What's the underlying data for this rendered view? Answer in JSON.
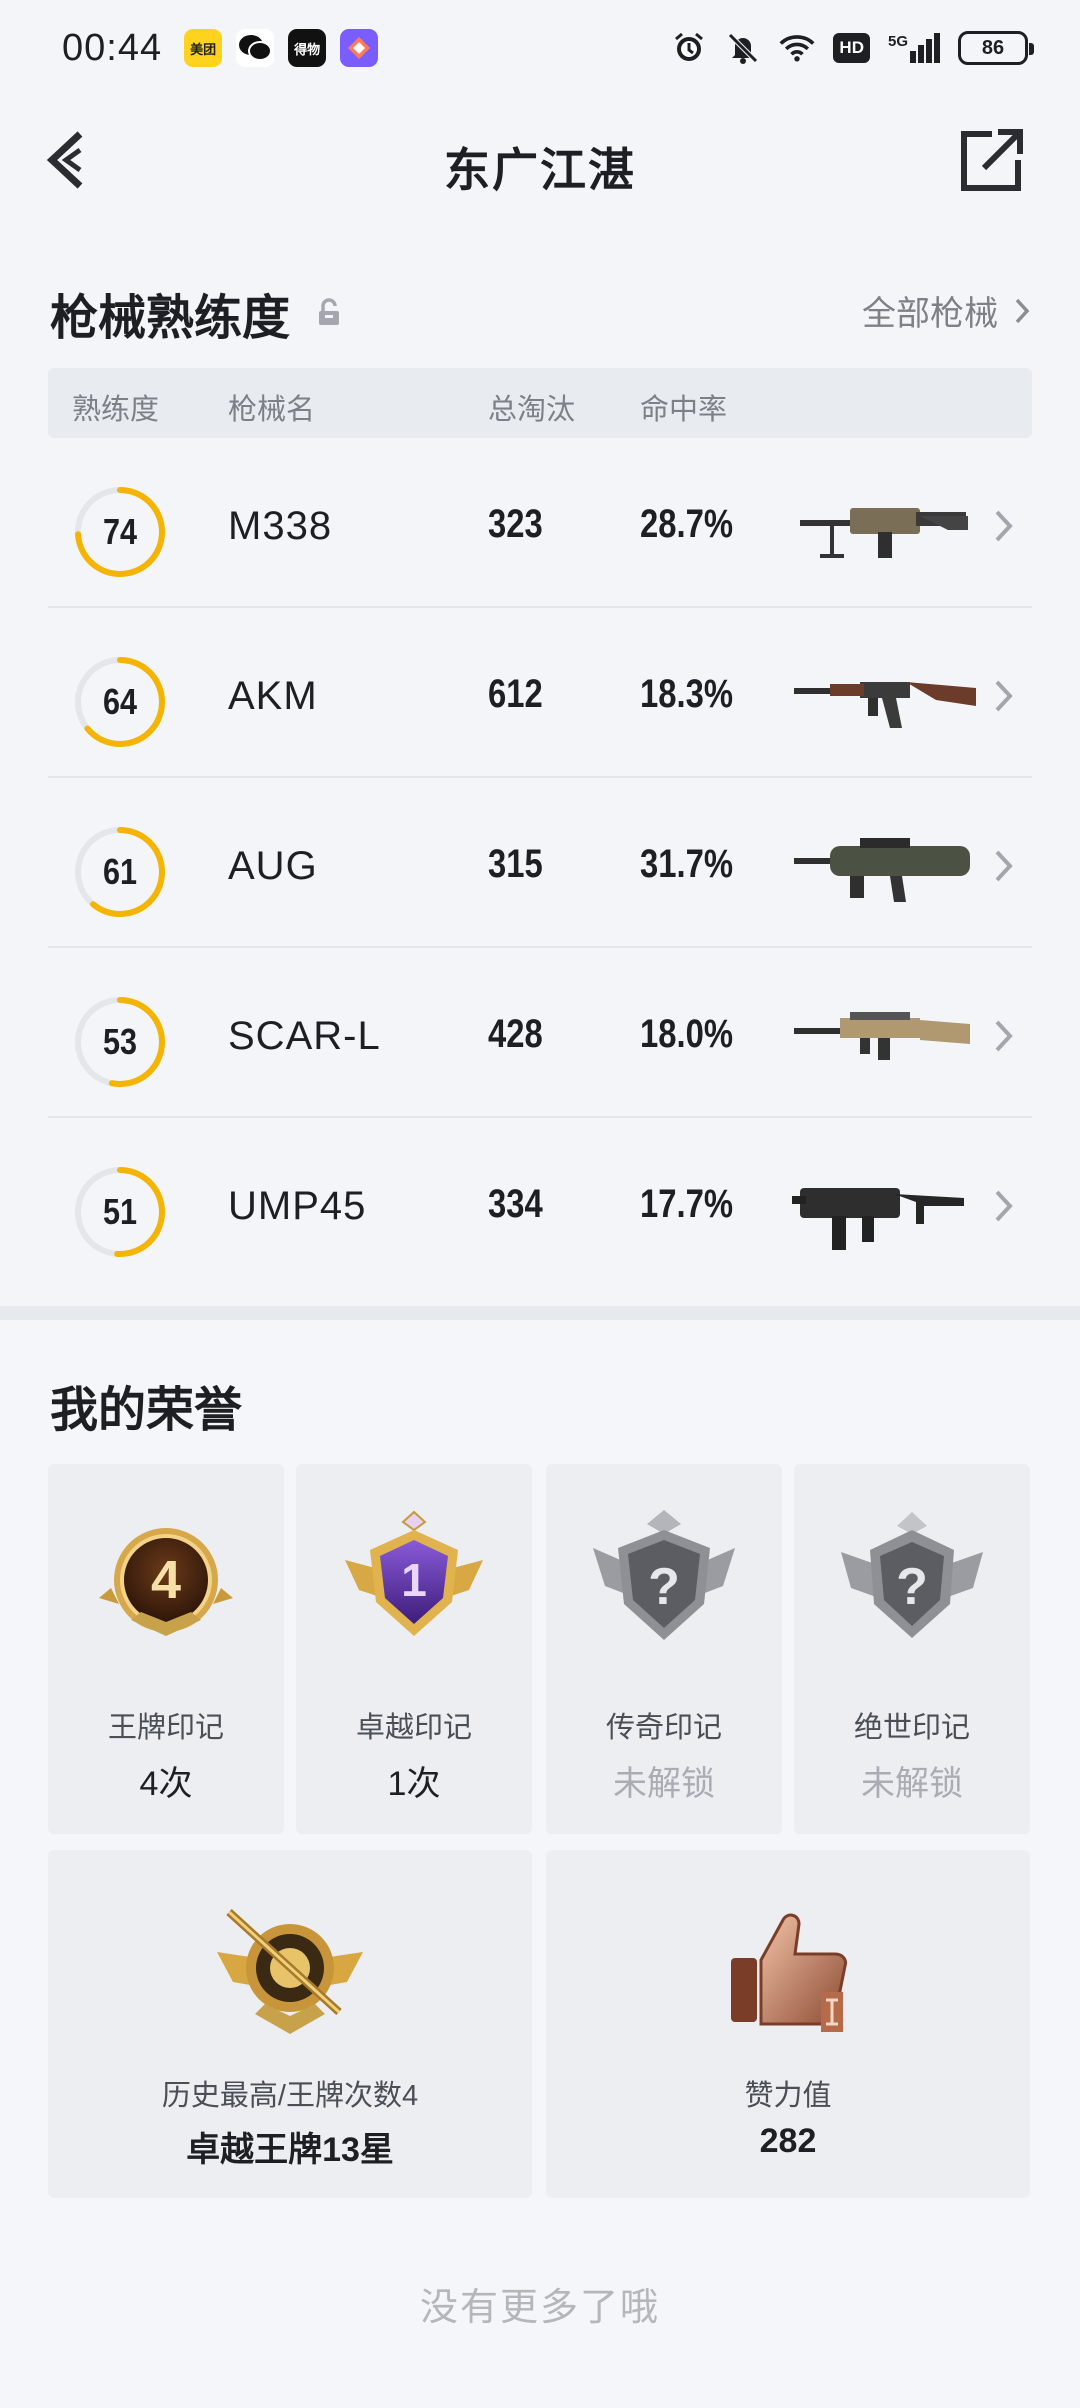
{
  "status_bar": {
    "time": "00:44",
    "apps": [
      {
        "name": "meituan-app-icon",
        "text": "美团",
        "bg": "#ffd21e",
        "fg": "#222222"
      },
      {
        "name": "wechat-app-icon",
        "text": "",
        "bg": "#ffffff",
        "fg": "#111111"
      },
      {
        "name": "dewu-app-icon",
        "text": "得物",
        "bg": "#111111",
        "fg": "#ffffff"
      },
      {
        "name": "shortcut-app-icon",
        "text": "",
        "bg": "#7b5cff",
        "fg": "#ffffff"
      }
    ],
    "hd": "HD",
    "signal": "5G",
    "battery": "86"
  },
  "nav": {
    "title": "东广江湛"
  },
  "weapons_section": {
    "title": "枪械熟练度",
    "all_link": "全部枪械",
    "columns": [
      "熟练度",
      "枪械名",
      "总淘汰",
      "命中率"
    ],
    "rows": [
      {
        "proficiency": "74",
        "name": "M338",
        "eliminations": "323",
        "hit_rate": "28.7%",
        "level": 0.74,
        "gun_color": "#7a6e56"
      },
      {
        "proficiency": "64",
        "name": "AKM",
        "eliminations": "612",
        "hit_rate": "18.3%",
        "level": 0.64,
        "gun_color": "#6b3c2a"
      },
      {
        "proficiency": "61",
        "name": "AUG",
        "eliminations": "315",
        "hit_rate": "31.7%",
        "level": 0.61,
        "gun_color": "#4c5243"
      },
      {
        "proficiency": "53",
        "name": "SCAR-L",
        "eliminations": "428",
        "hit_rate": "18.0%",
        "level": 0.53,
        "gun_color": "#b09870"
      },
      {
        "proficiency": "51",
        "name": "UMP45",
        "eliminations": "334",
        "hit_rate": "17.7%",
        "level": 0.51,
        "gun_color": "#2e2e2e"
      }
    ]
  },
  "honors_section": {
    "title": "我的荣誉",
    "cards": [
      {
        "label": "王牌印记",
        "value": "4次",
        "locked": false,
        "badge_text": "4"
      },
      {
        "label": "卓越印记",
        "value": "1次",
        "locked": false,
        "badge_text": "1"
      },
      {
        "label": "传奇印记",
        "value": "未解锁",
        "locked": true,
        "badge_text": "?"
      },
      {
        "label": "绝世印记",
        "value": "未解锁",
        "locked": true,
        "badge_text": "?"
      }
    ],
    "wide_cards": [
      {
        "label": "历史最高/王牌次数4",
        "value": "卓越王牌13星"
      },
      {
        "label": "赞力值",
        "value": "282"
      }
    ]
  },
  "footer": "没有更多了哦",
  "colors": {
    "ring_accent": "#f4b400",
    "ring_track": "#e4e6ea"
  }
}
